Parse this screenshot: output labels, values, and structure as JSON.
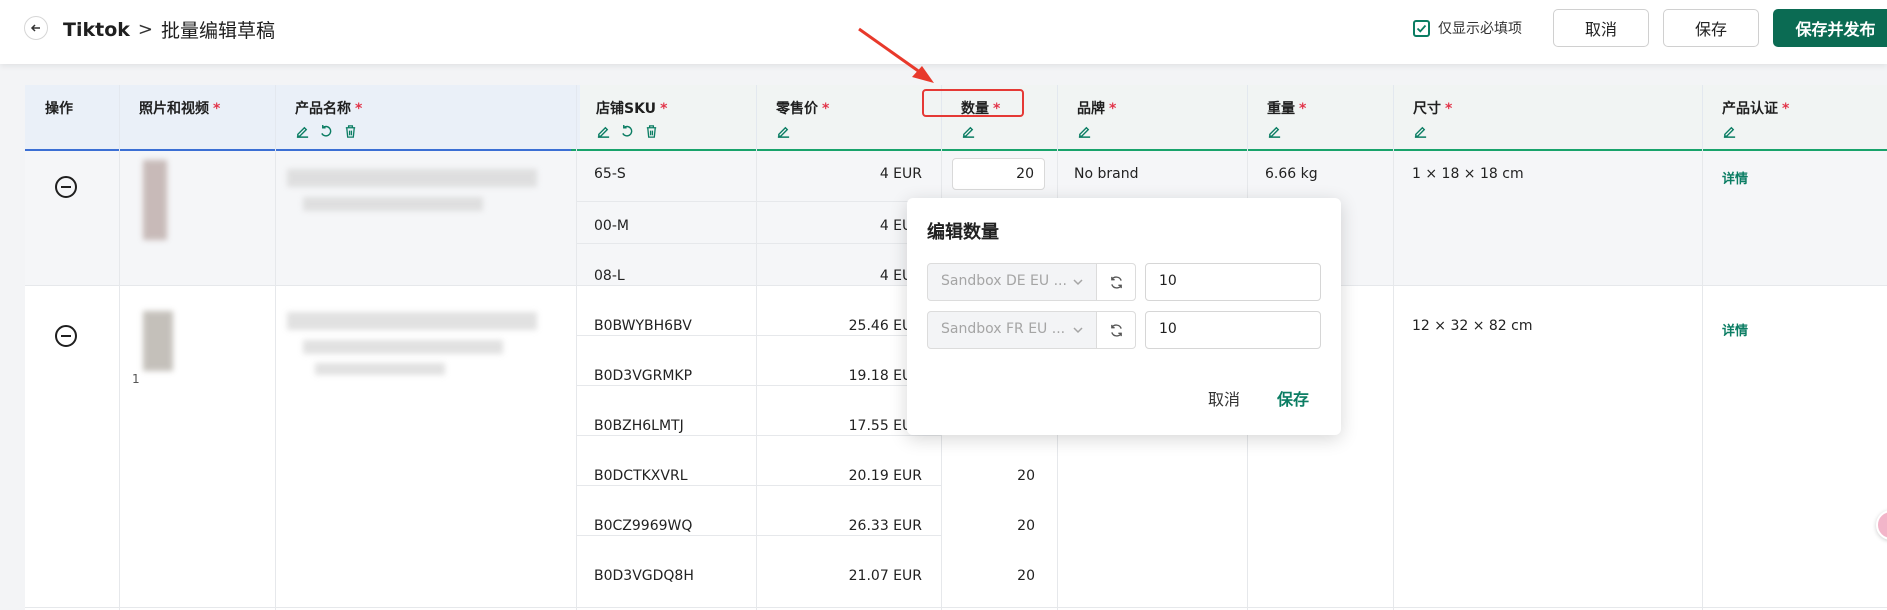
{
  "header": {
    "app_name": "Tiktok",
    "separator": ">",
    "page_title": "批量编辑草稿",
    "required_only_label": "仅显示必填项",
    "required_only_checked": true,
    "cancel_label": "取消",
    "save_label": "保存",
    "save_publish_label": "保存并发布"
  },
  "colors": {
    "accent": "#0b7d63",
    "primary_button": "#0b6b53",
    "required_star": "#e2364b",
    "highlight_box": "#e53935"
  },
  "columns": [
    {
      "key": "ops",
      "label": "操作",
      "required": false
    },
    {
      "key": "media",
      "label": "照片和视频",
      "required": true
    },
    {
      "key": "name",
      "label": "产品名称",
      "required": true
    },
    {
      "key": "sku",
      "label": "店铺SKU",
      "required": true
    },
    {
      "key": "price",
      "label": "零售价",
      "required": true
    },
    {
      "key": "qty",
      "label": "数量",
      "required": true
    },
    {
      "key": "brand",
      "label": "品牌",
      "required": true
    },
    {
      "key": "weight",
      "label": "重量",
      "required": true
    },
    {
      "key": "size",
      "label": "尺寸",
      "required": true
    },
    {
      "key": "cert",
      "label": "产品认证",
      "required": true
    }
  ],
  "required_mark": "*",
  "products": [
    {
      "variants": [
        {
          "sku": "65-S",
          "price": "4 EUR",
          "qty": "20"
        },
        {
          "sku": "00-M",
          "price": "4 EUR",
          "qty": ""
        },
        {
          "sku": "08-L",
          "price": "4 EUR",
          "qty": ""
        }
      ],
      "brand": "No brand",
      "weight": "6.66 kg",
      "size": "1 × 18 × 18 cm",
      "cert_link": "详情"
    },
    {
      "media_count": "1",
      "variants": [
        {
          "sku": "B0BWYBH6BV",
          "price": "25.46 EUR",
          "qty": ""
        },
        {
          "sku": "B0D3VGRMKP",
          "price": "19.18 EUR",
          "qty": ""
        },
        {
          "sku": "B0BZH6LMTJ",
          "price": "17.55 EUR",
          "qty": ""
        },
        {
          "sku": "B0DCTKXVRL",
          "price": "20.19 EUR",
          "qty": "20"
        },
        {
          "sku": "B0CZ9969WQ",
          "price": "26.33 EUR",
          "qty": "20"
        },
        {
          "sku": "B0D3VGDQ8H",
          "price": "21.07 EUR",
          "qty": "20"
        }
      ],
      "size": "12 × 32 × 82 cm",
      "cert_link": "详情"
    }
  ],
  "popover": {
    "title": "编辑数量",
    "rows": [
      {
        "warehouse": "Sandbox DE EU ...",
        "value": "10"
      },
      {
        "warehouse": "Sandbox FR EU ...",
        "value": "10"
      }
    ],
    "cancel_label": "取消",
    "save_label": "保存"
  },
  "icons": [
    "back-arrow-icon",
    "checkbox-checked-icon",
    "edit-icon",
    "undo-icon",
    "trash-icon",
    "remove-circle-icon",
    "chevron-down-icon",
    "refresh-icon",
    "annotation-arrow"
  ]
}
